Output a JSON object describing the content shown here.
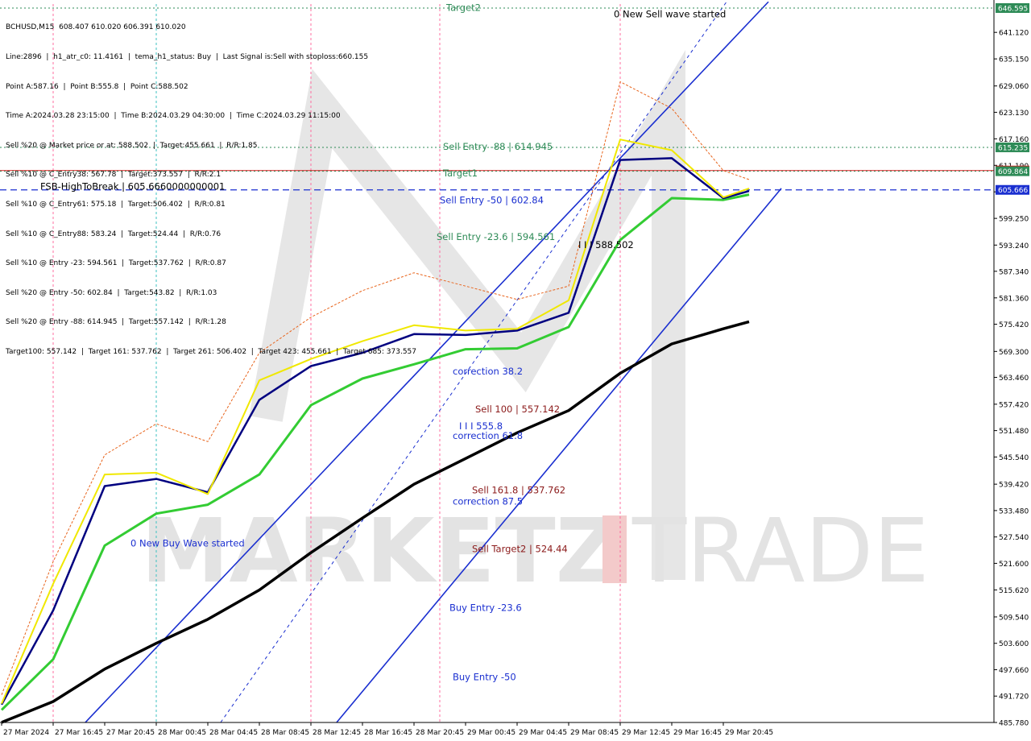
{
  "header": {
    "lines": [
      "BCHUSD,M15  608.407 610.020 606.391 610.020",
      "Line:2896  |  h1_atr_c0: 11.4161  |  tema_h1_status: Buy  |  Last Signal is:Sell with stoploss:660.155",
      "Point A:587.16  |  Point B:555.8  |  Point C:588.502",
      "Time A:2024.03.28 23:15:00  |  Time B:2024.03.29 04:30:00  |  Time C:2024.03.29 11:15:00",
      "Sell %20 @ Market price or at: 588.502  |  Target:455.661  |  R/R:1.85",
      "Sell %10 @ C_Entry38: 567.78  |  Target:373.557  |  R/R:2.1",
      "Sell %10 @ C_Entry61: 575.18  |  Target:506.402  |  R/R:0.81",
      "Sell %10 @ C_Entry88: 583.24  |  Target:524.44  |  R/R:0.76",
      "Sell %10 @ Entry -23: 594.561  |  Target:537.762  |  R/R:0.87",
      "Sell %20 @ Entry -50: 602.84  |  Target:543.82  |  R/R:1.03",
      "Sell %20 @ Entry -88: 614.945  |  Target:557.142  |  R/R:1.28",
      "Target100: 557.142  |  Target 161: 537.762  |  Target 261: 506.402  |  Target 423: 455.661  |  Target 685: 373.557"
    ]
  },
  "watermark": {
    "left": "MARKETZ",
    "right": "TRADE"
  },
  "chart_data": {
    "type": "line",
    "symbol": "BCHUSD",
    "timeframe": "M15",
    "ylim": [
      485.78,
      647.5
    ],
    "y_ticks": [
      "641.120",
      "635.150",
      "629.060",
      "623.130",
      "617.160",
      "611.190",
      "605.220",
      "599.250",
      "593.240",
      "587.340",
      "581.360",
      "575.420",
      "569.300",
      "563.460",
      "557.420",
      "551.480",
      "545.540",
      "539.420",
      "533.480",
      "527.540",
      "521.600",
      "515.620",
      "509.540",
      "503.600",
      "497.660",
      "491.720",
      "485.780"
    ],
    "x_ticks": [
      "27 Mar 2024",
      "27 Mar 16:45",
      "27 Mar 20:45",
      "28 Mar 00:45",
      "28 Mar 04:45",
      "28 Mar 08:45",
      "28 Mar 12:45",
      "28 Mar 16:45",
      "28 Mar 20:45",
      "29 Mar 00:45",
      "29 Mar 04:45",
      "29 Mar 08:45",
      "29 Mar 12:45",
      "29 Mar 16:45",
      "29 Mar 20:45"
    ],
    "price_flags": [
      {
        "value": 646.595,
        "label": "646.595",
        "color": "#2e8b57"
      },
      {
        "value": 615.235,
        "label": "615.235",
        "color": "#2e8b57"
      },
      {
        "value": 610.02,
        "label": "610.020",
        "color": "#d41c1c"
      },
      {
        "value": 609.864,
        "label": "609.864",
        "color": "#2e8b57"
      },
      {
        "value": 605.666,
        "label": "605.666",
        "color": "#1a2fd0"
      }
    ],
    "horizontal_lines": [
      {
        "value": 646.595,
        "color": "#2e8b57",
        "style": "dotted"
      },
      {
        "value": 615.235,
        "color": "#2e8b57",
        "style": "dotted"
      },
      {
        "value": 610.02,
        "color": "#d41c1c",
        "style": "solid"
      },
      {
        "value": 609.864,
        "color": "#2e8b57",
        "style": "dotted"
      },
      {
        "value": 605.666,
        "color": "#1a2fd0",
        "style": "dashed"
      }
    ],
    "annotations": [
      {
        "text": "Target2",
        "x": "28 Mar 22:30",
        "y": 646.0,
        "color": "#2e8b57"
      },
      {
        "text": "0 New Sell wave started",
        "x": "29 Mar 11:30",
        "y": 644.5,
        "color": "#000000"
      },
      {
        "text": "Sell Entry -88 | 614.945",
        "x": "28 Mar 22:15",
        "y": 614.7,
        "color": "#2e8b57"
      },
      {
        "text": "Target1",
        "x": "28 Mar 22:15",
        "y": 608.7,
        "color": "#2e8b57"
      },
      {
        "text": "FSB-HighToBreak | 605.6660000000001",
        "x": "27 Mar 15:00",
        "y": 605.666,
        "color": "#000000"
      },
      {
        "text": "Sell Entry -50 | 602.84",
        "x": "28 Mar 22:00",
        "y": 602.6,
        "color": "#1a2fd0"
      },
      {
        "text": "Sell Entry -23.6 | 594.561",
        "x": "28 Mar 21:45",
        "y": 594.4,
        "color": "#2e8b57"
      },
      {
        "text": "I I I 588.502",
        "x": "29 Mar 08:45",
        "y": 592.6,
        "color": "#000000"
      },
      {
        "text": "correction 38.2",
        "x": "28 Mar 23:00",
        "y": 564.1,
        "color": "#1a2fd0"
      },
      {
        "text": "Sell 100 | 557.142",
        "x": "29 Mar 00:45",
        "y": 555.6,
        "color": "#8b1a1a"
      },
      {
        "text": "I I I 555.8",
        "x": "28 Mar 23:30",
        "y": 551.8,
        "color": "#1a2fd0"
      },
      {
        "text": "correction 61.8",
        "x": "28 Mar 23:00",
        "y": 549.6,
        "color": "#1a2fd0"
      },
      {
        "text": "Sell 161.8 | 537.762",
        "x": "29 Mar 00:30",
        "y": 537.4,
        "color": "#8b1a1a"
      },
      {
        "text": "correction 87.5",
        "x": "28 Mar 23:00",
        "y": 534.8,
        "color": "#1a2fd0"
      },
      {
        "text": "0 New Buy Wave started",
        "x": "27 Mar 22:00",
        "y": 525.4,
        "color": "#1a2fd0"
      },
      {
        "text": "Sell Target2 | 524.44",
        "x": "29 Mar 00:30",
        "y": 524.1,
        "color": "#8b1a1a"
      },
      {
        "text": "Buy Entry -23.6",
        "x": "28 Mar 22:45",
        "y": 510.9,
        "color": "#1a2fd0"
      },
      {
        "text": "Buy Entry -50",
        "x": "28 Mar 23:00",
        "y": 495.3,
        "color": "#1a2fd0"
      }
    ],
    "series": [
      {
        "name": "",
        "color": "#000000",
        "points": [
          [
            "27 Mar 12:00",
            485.8
          ],
          [
            "27 Mar 16:00",
            490.5
          ],
          [
            "27 Mar 20:00",
            497.8
          ],
          [
            "28 Mar 00:00",
            503.6
          ],
          [
            "28 Mar 04:00",
            509.0
          ],
          [
            "28 Mar 08:00",
            515.6
          ],
          [
            "28 Mar 12:00",
            524.0
          ],
          [
            "28 Mar 16:00",
            531.8
          ],
          [
            "28 Mar 20:00",
            539.4
          ],
          [
            "29 Mar 00:00",
            545.2
          ],
          [
            "29 Mar 04:00",
            551.0
          ],
          [
            "29 Mar 08:00",
            556.0
          ],
          [
            "29 Mar 12:00",
            564.4
          ],
          [
            "29 Mar 16:00",
            571.0
          ],
          [
            "29 Mar 20:00",
            574.4
          ],
          [
            "29 Mar 22:00",
            576.0
          ]
        ]
      },
      {
        "name": "",
        "color": "#33cc33",
        "points": [
          [
            "27 Mar 12:00",
            488.6
          ],
          [
            "27 Mar 16:00",
            500.0
          ],
          [
            "27 Mar 20:00",
            525.6
          ],
          [
            "28 Mar 00:00",
            532.8
          ],
          [
            "28 Mar 04:00",
            534.8
          ],
          [
            "28 Mar 08:00",
            541.6
          ],
          [
            "28 Mar 12:00",
            557.2
          ],
          [
            "28 Mar 16:00",
            563.2
          ],
          [
            "28 Mar 20:00",
            566.4
          ],
          [
            "29 Mar 00:00",
            569.8
          ],
          [
            "29 Mar 04:00",
            570.0
          ],
          [
            "29 Mar 08:00",
            574.8
          ],
          [
            "29 Mar 12:00",
            594.4
          ],
          [
            "29 Mar 16:00",
            603.8
          ],
          [
            "29 Mar 20:00",
            603.4
          ],
          [
            "29 Mar 22:00",
            604.6
          ]
        ]
      },
      {
        "name": "",
        "color": "#000080",
        "points": [
          [
            "27 Mar 12:00",
            489.8
          ],
          [
            "27 Mar 16:00",
            511.0
          ],
          [
            "27 Mar 20:00",
            539.0
          ],
          [
            "28 Mar 00:00",
            540.6
          ],
          [
            "28 Mar 04:00",
            537.6
          ],
          [
            "28 Mar 08:00",
            558.4
          ],
          [
            "28 Mar 12:00",
            566.0
          ],
          [
            "28 Mar 16:00",
            569.0
          ],
          [
            "28 Mar 20:00",
            573.2
          ],
          [
            "29 Mar 00:00",
            573.0
          ],
          [
            "29 Mar 04:00",
            574.0
          ],
          [
            "29 Mar 08:00",
            578.0
          ],
          [
            "29 Mar 12:00",
            612.4
          ],
          [
            "29 Mar 16:00",
            612.8
          ],
          [
            "29 Mar 20:00",
            603.8
          ],
          [
            "29 Mar 22:00",
            605.4
          ]
        ]
      },
      {
        "name": "",
        "color": "#f0e800",
        "points": [
          [
            "27 Mar 12:00",
            490.0
          ],
          [
            "27 Mar 16:00",
            517.0
          ],
          [
            "27 Mar 20:00",
            541.6
          ],
          [
            "28 Mar 00:00",
            542.0
          ],
          [
            "28 Mar 04:00",
            537.2
          ],
          [
            "28 Mar 08:00",
            562.8
          ],
          [
            "28 Mar 12:00",
            567.6
          ],
          [
            "28 Mar 16:00",
            571.6
          ],
          [
            "28 Mar 20:00",
            575.2
          ],
          [
            "29 Mar 00:00",
            574.0
          ],
          [
            "29 Mar 04:00",
            574.4
          ],
          [
            "29 Mar 08:00",
            580.8
          ],
          [
            "29 Mar 12:00",
            617.0
          ],
          [
            "29 Mar 16:00",
            614.6
          ],
          [
            "29 Mar 20:00",
            604.0
          ],
          [
            "29 Mar 22:00",
            606.0
          ]
        ]
      },
      {
        "name": "",
        "color": "#e8641c",
        "points": [
          [
            "27 Mar 12:00",
            492.0
          ],
          [
            "27 Mar 16:00",
            522.0
          ],
          [
            "27 Mar 20:00",
            546.0
          ],
          [
            "28 Mar 00:00",
            553.0
          ],
          [
            "28 Mar 04:00",
            549.0
          ],
          [
            "28 Mar 08:00",
            569.0
          ],
          [
            "28 Mar 12:00",
            577.0
          ],
          [
            "28 Mar 16:00",
            583.0
          ],
          [
            "28 Mar 20:00",
            587.0
          ],
          [
            "29 Mar 00:00",
            584.0
          ],
          [
            "29 Mar 04:00",
            581.0
          ],
          [
            "29 Mar 08:00",
            584.0
          ],
          [
            "29 Mar 12:00",
            630.0
          ],
          [
            "29 Mar 16:00",
            624.0
          ],
          [
            "29 Mar 20:00",
            610.0
          ],
          [
            "29 Mar 22:00",
            608.0
          ]
        ]
      }
    ]
  }
}
